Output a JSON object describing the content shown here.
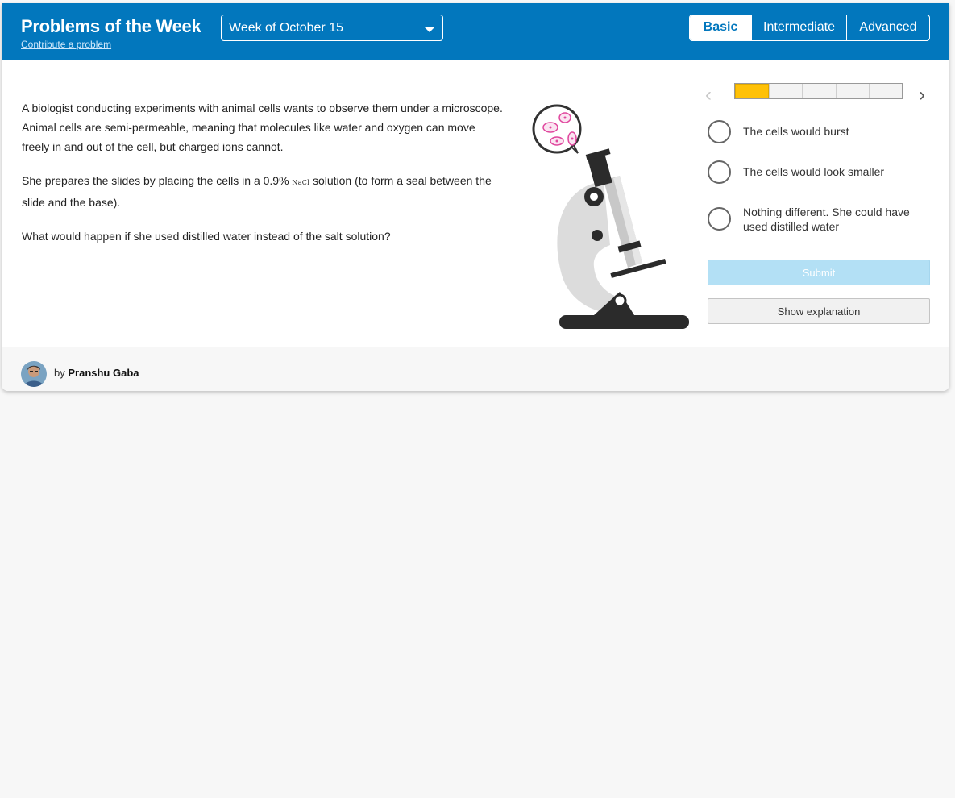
{
  "header": {
    "title": "Problems of the Week",
    "contribute_link": "Contribute a problem",
    "week_select": "Week of October 15",
    "levels": [
      "Basic",
      "Intermediate",
      "Advanced"
    ],
    "active_level": "Basic"
  },
  "problem": {
    "paragraph1": "A biologist conducting experiments with animal cells wants to observe them under a microscope. Animal cells are semi-permeable, meaning that molecules like water and oxygen can move freely in and out of the cell, but charged ions cannot.",
    "paragraph2_before": "She prepares the slides by placing the cells in a 0.9% ",
    "paragraph2_formula": "NaCl",
    "paragraph2_after": " solution (to form a seal between the slide and the base).",
    "question": "What would happen if she used distilled water instead of the salt solution?"
  },
  "progress": {
    "current": 1,
    "total": 5
  },
  "options": [
    "The cells would burst",
    "The cells would look smaller",
    "Nothing different. She could have used distilled water"
  ],
  "buttons": {
    "submit": "Submit",
    "show_explanation": "Show explanation"
  },
  "footer": {
    "by": "by",
    "author": "Pranshu Gaba"
  },
  "colors": {
    "header_bg": "#0277bd",
    "progress_fill": "#ffc107",
    "submit_disabled": "#b3e0f5"
  }
}
